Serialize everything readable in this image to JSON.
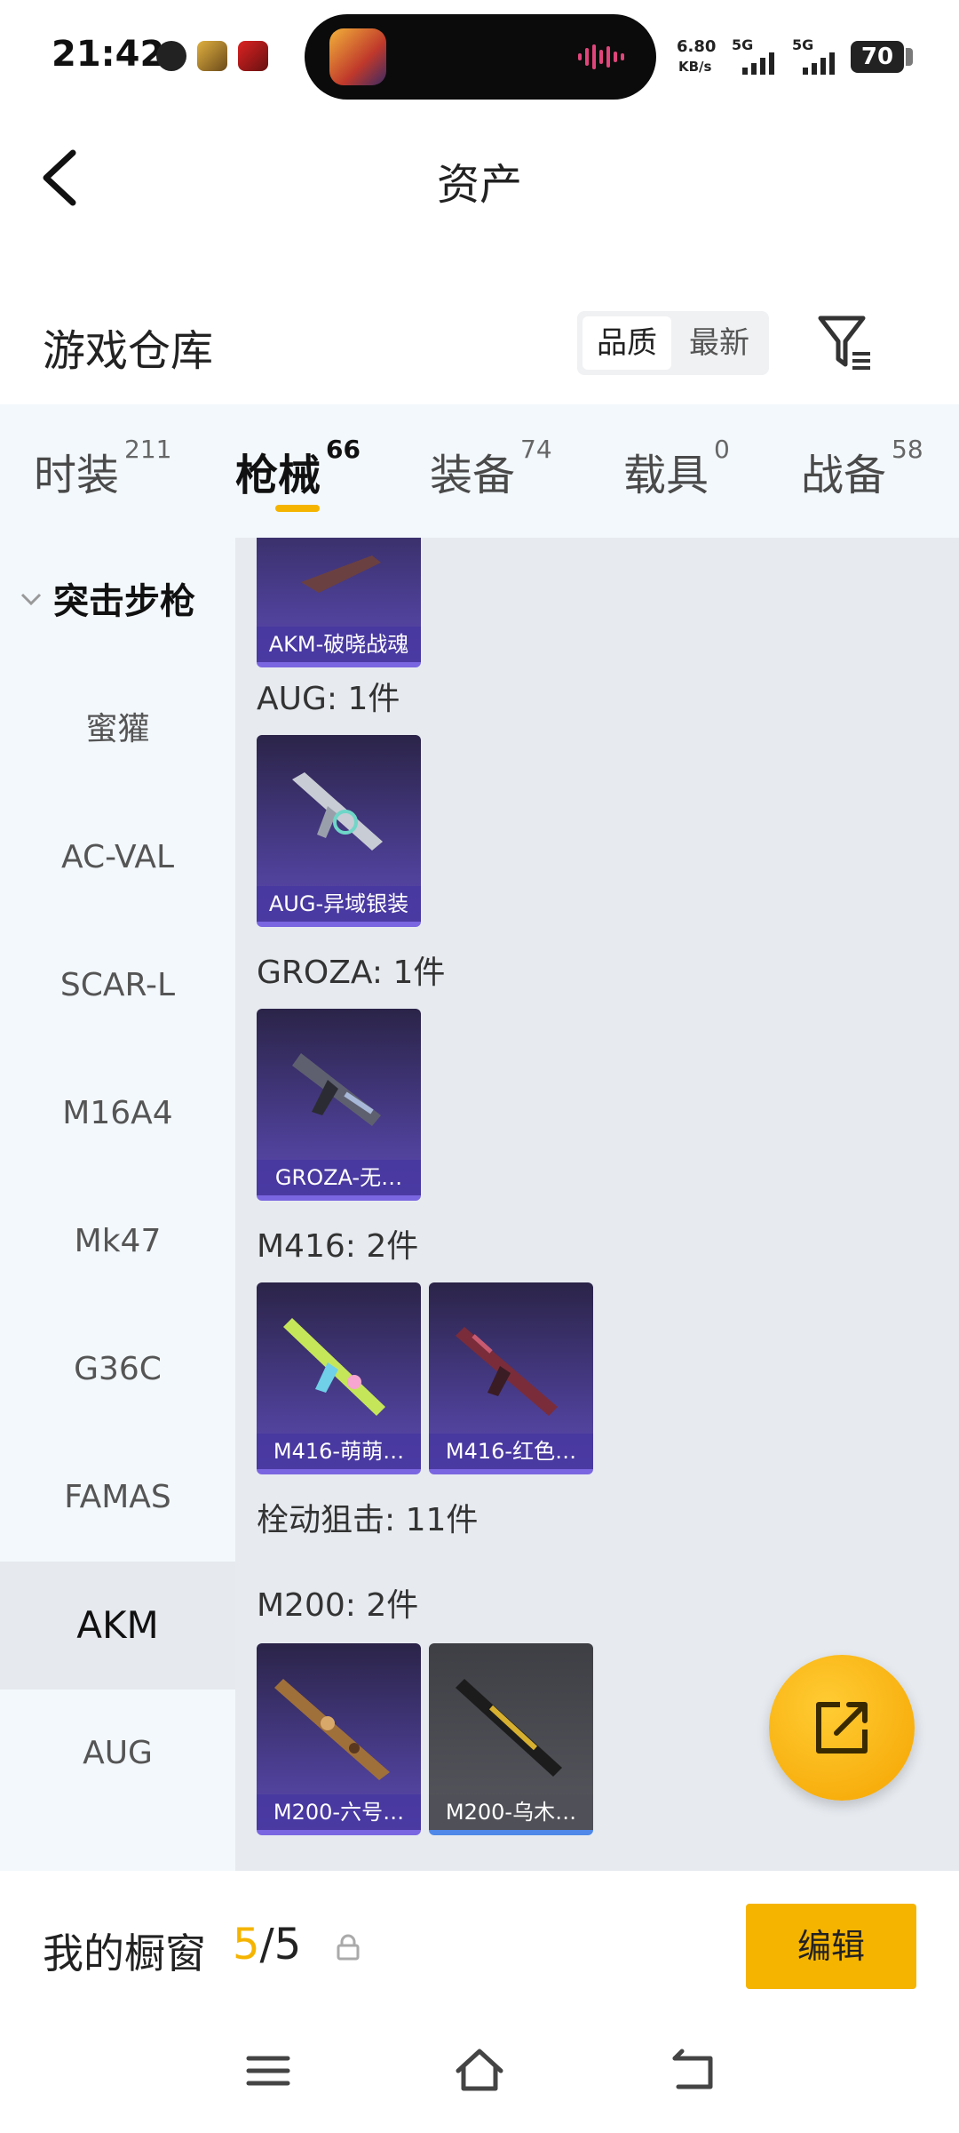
{
  "status_bar": {
    "time": "21:42",
    "network_speed": "6.80",
    "network_unit": "KB/s",
    "signal_1": "5G",
    "signal_2": "5G",
    "battery": "70"
  },
  "header": {
    "title": "资产"
  },
  "section": {
    "title": "游戏仓库",
    "sort_options": [
      "品质",
      "最新"
    ],
    "sort_selected": "品质"
  },
  "tabs": [
    {
      "label": "时装",
      "count": "211"
    },
    {
      "label": "枪械",
      "count": "66"
    },
    {
      "label": "装备",
      "count": "74"
    },
    {
      "label": "载具",
      "count": "0"
    },
    {
      "label": "战备",
      "count": "58"
    }
  ],
  "active_tab": "枪械",
  "sidebar": {
    "group": "突击步枪",
    "items": [
      "蜜獾",
      "AC-VAL",
      "SCAR-L",
      "M16A4",
      "Mk47",
      "G36C",
      "FAMAS",
      "AKM",
      "AUG"
    ],
    "selected": "AKM"
  },
  "content": {
    "partial_card": "AKM-破晓战魂",
    "groups": [
      {
        "label": "AUG: 1件",
        "cards": [
          "AUG-异域银装"
        ]
      },
      {
        "label": "GROZA: 1件",
        "cards": [
          "GROZA-无…"
        ]
      },
      {
        "label": "M416: 2件",
        "cards": [
          "M416-萌萌…",
          "M416-红色…"
        ]
      },
      {
        "label": "栓动狙击: 11件",
        "cards": []
      },
      {
        "label": "M200: 2件",
        "cards": [
          "M200-六号…",
          "M200-乌木…"
        ]
      }
    ]
  },
  "bottom": {
    "showcase_label": "我的橱窗",
    "showcase_current": "5",
    "showcase_total": "/5",
    "edit_label": "编辑"
  },
  "colors": {
    "accent": "#f5b400",
    "card_purple": "#4a3d8f",
    "sidebar_bg": "#f3f8fc",
    "content_bg": "#e7ebf0"
  },
  "icons": [
    "back-icon",
    "filter-icon",
    "share-icon",
    "lock-icon",
    "menu-icon",
    "home-icon",
    "return-icon"
  ]
}
